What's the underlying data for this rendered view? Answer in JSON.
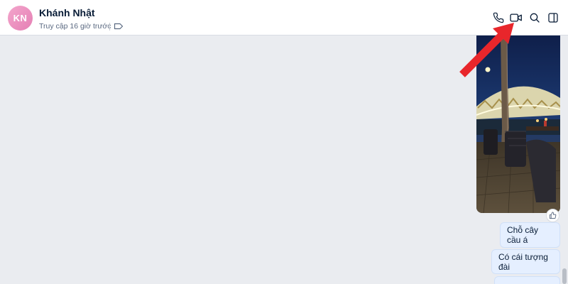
{
  "header": {
    "avatar_initials": "KN",
    "contact_name": "Khánh Nhật",
    "last_seen": "Truy cập 16 giờ trước",
    "actions": {
      "call_icon": "phone-icon",
      "video_icon": "video-camera-icon",
      "search_icon": "search-icon",
      "panel_icon": "sidebar-panel-icon"
    }
  },
  "messages": [
    {
      "type": "image",
      "description": "photo",
      "reaction_icon": "thumbs-up-icon"
    },
    {
      "type": "text",
      "text": "Chỗ cây cầu á"
    },
    {
      "type": "text",
      "text": "Có cái tượng đài"
    },
    {
      "type": "text",
      "text": ""
    }
  ],
  "colors": {
    "background": "#eaecf0",
    "bubble": "#e5efff",
    "annotation_arrow": "#e8262b"
  }
}
